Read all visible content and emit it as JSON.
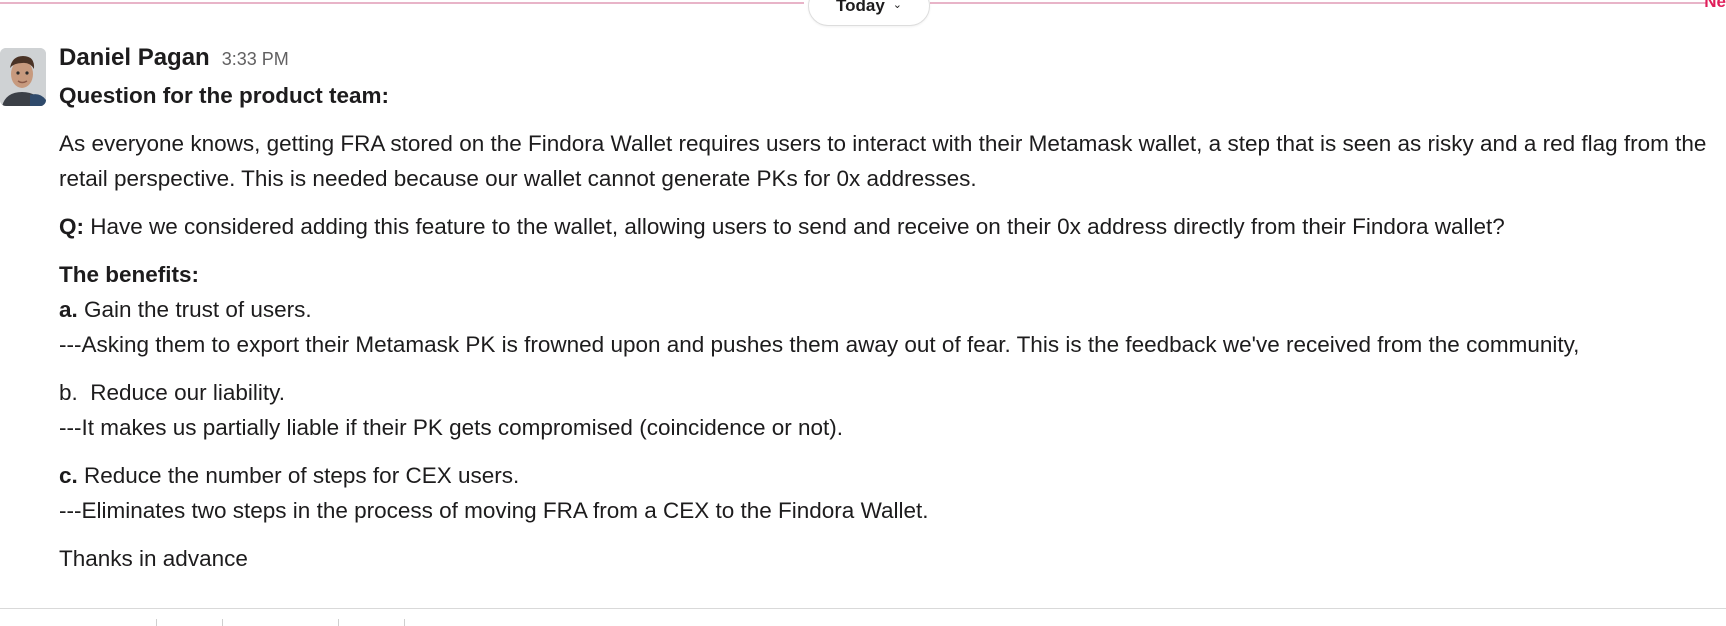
{
  "divider": {
    "date_label": "Today",
    "new_label": "Ne"
  },
  "message": {
    "author": "Daniel Pagan",
    "time": "3:33 PM",
    "title": "Question for the product team:",
    "intro": "As everyone knows, getting FRA stored on the Findora Wallet requires users to interact with their Metamask wallet, a step that is seen as risky and a red flag from the retail perspective. This is needed because our wallet cannot generate PKs for 0x addresses.",
    "question_prefix": "Q:",
    "question": " Have we considered adding this feature to the wallet, allowing users to send and receive on their 0x address directly from their Findora wallet?",
    "benefits_heading": "The benefits:",
    "benefit_a_prefix": "a.",
    "benefit_a": " Gain the trust of users.",
    "benefit_a_detail": "---Asking them to export their Metamask PK is frowned upon and pushes them away out of fear. This is the feedback we've received from the community,",
    "benefit_b": "b.  Reduce our liability.",
    "benefit_b_detail": "---It makes us partially liable if their PK gets compromised (coincidence or not).",
    "benefit_c_prefix": "c.",
    "benefit_c": " Reduce the number of steps for CEX users.",
    "benefit_c_detail": "---Eliminates two steps in the process of moving FRA from a CEX to the Findora Wallet.",
    "closing": "Thanks in advance"
  }
}
